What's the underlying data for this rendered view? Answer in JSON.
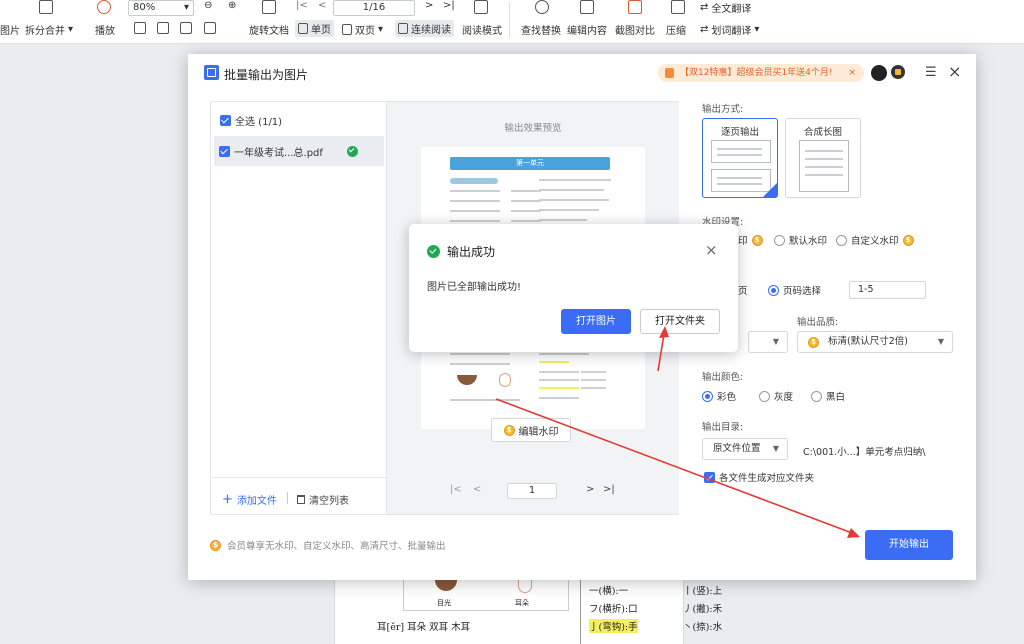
{
  "toolbar": {
    "items": {
      "to_image": "图片",
      "split_merge": "拆分合并",
      "play": "播放",
      "zoom": "80%",
      "rotate": "旋转文档",
      "single": "单页",
      "double": "双页",
      "continuous": "连续阅读",
      "reading_mode": "阅读模式",
      "find_replace": "查找替换",
      "edit_content": "编辑内容",
      "screenshot_compare": "截图对比",
      "compress": "压缩",
      "full_translate": "全文翻译",
      "word_translate": "划词翻译"
    },
    "page_input": "1/16"
  },
  "dialog": {
    "title": "批量输出为图片",
    "promo": "【双12特惠】超级会员买1年送4个月!",
    "file_list": {
      "select_all": "全选 (1/1)",
      "file_name": "一年级考试...总.pdf",
      "add_file": "添加文件",
      "clear_list": "清空列表"
    },
    "preview": {
      "label": "输出效果预览",
      "edit_watermark": "编辑水印",
      "page_number": "1",
      "page_heading": "第一单元"
    },
    "settings": {
      "output_mode_label": "输出方式:",
      "mode_per_page": "逐页输出",
      "mode_long": "合成长图",
      "watermark_label": "水印设置:",
      "wm_none_partial": "印",
      "wm_default": "默认水印",
      "wm_custom": "自定义水印",
      "page_partial": "页",
      "page_select": "页码选择",
      "page_range": "1-5",
      "quality_label": "输出品质:",
      "quality_value": "标清(默认尺寸2倍)",
      "color_label": "输出颜色:",
      "color_color": "彩色",
      "color_gray": "灰度",
      "color_bw": "黑白",
      "dir_label": "输出目录:",
      "dir_select": "原文件位置",
      "dir_path": "C:\\001.小...】单元考点归纳\\",
      "subfolder": "各文件生成对应文件夹"
    },
    "footer": {
      "member_note": "会员尊享无水印、自定义水印、高清尺寸、批量输出",
      "start": "开始输出"
    }
  },
  "modal": {
    "title": "输出成功",
    "message": "图片已全部输出成功!",
    "open_image": "打开图片",
    "open_folder": "打开文件夹"
  },
  "background_doc": {
    "eye_label": "目光",
    "ear_label": "耳朵",
    "line1": "耳[ěr] 耳朵  双耳  木耳",
    "stroke1": "一(横):一",
    "stroke2": "丨(竖):上",
    "stroke3": "フ(横折):口",
    "stroke4": "丿(撇):禾",
    "stroke5": "亅(弯钩):手",
    "stroke6": "丶(捺):水"
  },
  "colors": {
    "accent": "#3a6cf5",
    "success": "#22a854",
    "promo_bg": "#fdebd7",
    "promo_text": "#e5612a",
    "annotation_red": "#e53935"
  }
}
